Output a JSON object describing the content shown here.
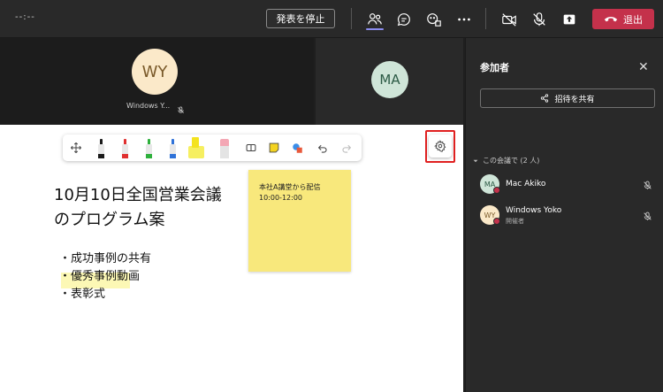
{
  "topbar": {
    "timer": "--:--",
    "stop_presenting": "発表を停止",
    "leave": "退出",
    "icons": [
      "people-icon",
      "chat-icon",
      "reactions-icon",
      "more-icon",
      "camera-off-icon",
      "mic-off-icon",
      "share-icon"
    ]
  },
  "video": {
    "tile1": {
      "initials": "WY",
      "name": "Windows Y..."
    },
    "tile2": {
      "initials": "MA"
    }
  },
  "board": {
    "title_line1": "10月10日全国営業会議",
    "title_line2": "のプログラム案",
    "bullets": [
      "・成功事例の共有",
      "・優秀事例動画",
      "・表彰式"
    ],
    "sticky_line1": "本社A講堂から配信",
    "sticky_line2": "10:00-12:00",
    "pen_colors": [
      "#1a1a1a",
      "#e03030",
      "#2eb03c",
      "#2f72d8",
      "#f4e31f",
      "#f3a7b4"
    ]
  },
  "panel": {
    "title": "参加者",
    "share_invite": "招待を共有",
    "section_label": "この会議で (2 人)",
    "participants": [
      {
        "initials": "MA",
        "name": "Mac Akiko",
        "role": ""
      },
      {
        "initials": "WY",
        "name": "Windows Yoko",
        "role": "開催者"
      }
    ]
  },
  "colors": {
    "accent": "#8b8cf0",
    "leave": "#c4314b",
    "sticky": "#f8e87c",
    "highlight_box": "#e02020"
  }
}
